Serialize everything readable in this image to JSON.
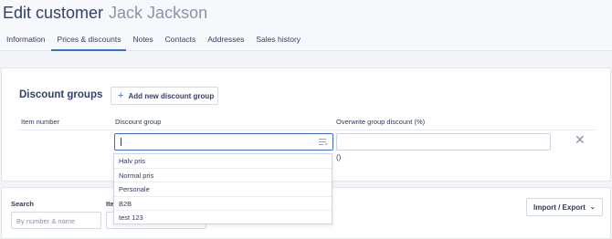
{
  "page": {
    "title": "Edit customer",
    "customer_name": "Jack Jackson"
  },
  "tabs": [
    {
      "label": "Information",
      "active": false
    },
    {
      "label": "Prices & discounts",
      "active": true
    },
    {
      "label": "Notes",
      "active": false
    },
    {
      "label": "Contacts",
      "active": false
    },
    {
      "label": "Addresses",
      "active": false
    },
    {
      "label": "Sales history",
      "active": false
    }
  ],
  "discount_groups": {
    "title": "Discount groups",
    "add_button_label": "Add new discount group",
    "columns": [
      "Item number",
      "Discount group",
      "Overwrite group discount (%)"
    ],
    "row": {
      "discount_group_value": "",
      "overwrite_value": "",
      "overwrite_note": "()"
    },
    "options": [
      "Halv pris",
      "Normal pris",
      "Personale",
      "B2B",
      "test 123"
    ]
  },
  "filters": {
    "search_label": "Search",
    "search_placeholder": "By number & name",
    "item_label": "Ite",
    "import_export_label": "Import / Export"
  },
  "colors": {
    "accent": "#3b6fc4",
    "text": "#34406a",
    "background": "#f2f4f8"
  }
}
